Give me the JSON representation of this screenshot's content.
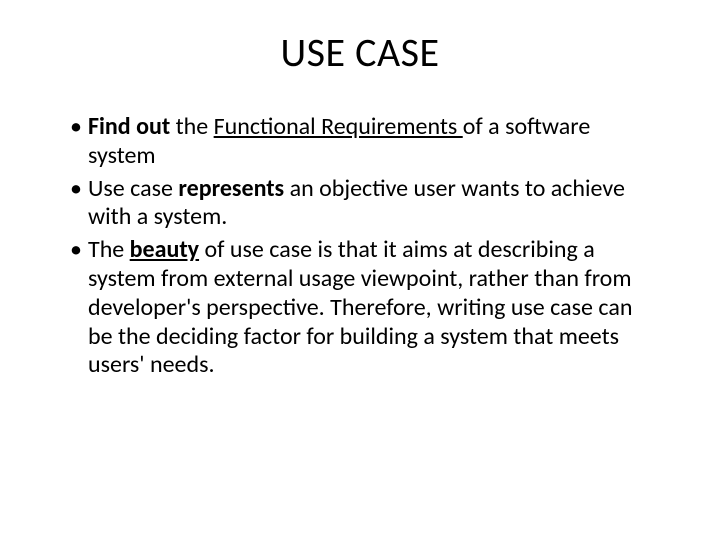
{
  "title": "USE CASE",
  "bullets": [
    {
      "seg1_b": "Find out ",
      "seg2": "the ",
      "seg3_u": "Functional Requirements ",
      "seg4": "of a software system"
    },
    {
      "seg1": "Use case ",
      "seg2_b": "represents",
      "seg3": " an objective user wants to achieve with a system."
    },
    {
      "seg1": "The ",
      "seg2_bu": "beauty",
      "seg3": " of use case is that it aims at describing a system from external usage viewpoint, rather than from developer's perspective. Therefore, writing use case can be the deciding factor for building a system that meets users' needs."
    }
  ]
}
